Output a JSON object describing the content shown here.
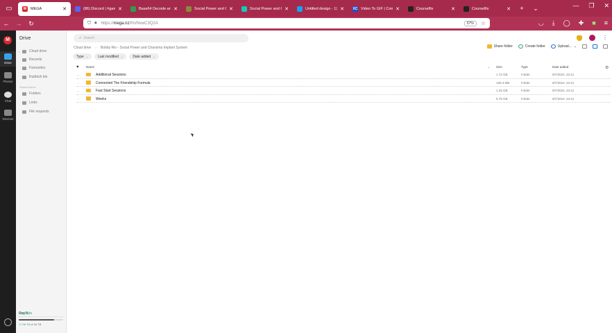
{
  "browser": {
    "tabs": [
      {
        "title": "MEGA",
        "color": "#d9272e",
        "icon": "mega-logo-icon",
        "active": true,
        "fav": "M"
      },
      {
        "title": "(86) Discord | #gam",
        "color": "#5865f2",
        "icon": "discord-icon",
        "active": false,
        "fav": ""
      },
      {
        "title": "Base64 Decode and E",
        "color": "#2e9e4a",
        "icon": "base64-icon",
        "active": false,
        "fav": ""
      },
      {
        "title": "Social Power and Cha",
        "color": "#8a8a3a",
        "icon": "page-icon",
        "active": false,
        "fav": ""
      },
      {
        "title": "Social Power and Cha",
        "color": "#16c7b8",
        "icon": "canva-icon",
        "active": false,
        "fav": ""
      },
      {
        "title": "Untitled design - 120",
        "color": "#1aa1f0",
        "icon": "canva-icon",
        "active": false,
        "fav": ""
      },
      {
        "title": "Video To GIF | Conver",
        "color": "#1f4fd1",
        "icon": "xc-icon",
        "active": false,
        "fav": "XC"
      },
      {
        "title": "Courseflix",
        "color": "#222222",
        "icon": "courseflix-icon",
        "active": false,
        "fav": ""
      },
      {
        "title": "Courseflix",
        "color": "#222222",
        "icon": "courseflix-icon",
        "active": false,
        "fav": ""
      }
    ],
    "url_host": "mega.nz",
    "url_prefix": "https://",
    "url_path": "/fm/NxwC3Q2A",
    "zoom": "67%"
  },
  "rail": {
    "items": [
      {
        "label": "Drive",
        "active": true
      },
      {
        "label": "Photos",
        "active": false
      },
      {
        "label": "Chat",
        "active": false
      },
      {
        "label": "Devices",
        "active": false
      }
    ]
  },
  "sidebar": {
    "title": "Drive",
    "items": [
      {
        "label": "Cloud drive",
        "icon": "cloud-icon"
      },
      {
        "label": "Recents",
        "icon": "clock-icon"
      },
      {
        "label": "Favourites",
        "icon": "heart-icon"
      },
      {
        "label": "Rubbish bin",
        "icon": "trash-icon"
      }
    ],
    "section": "Shared items",
    "shared": [
      {
        "label": "Folders",
        "icon": "shared-folder-icon"
      },
      {
        "label": "Links",
        "icon": "link-icon"
      },
      {
        "label": "File requests",
        "icon": "file-request-icon"
      }
    ],
    "storage": {
      "plan": "Pro III",
      "upgrade": "Upgrade",
      "used": "17.98 TB",
      "of": "of 16 TB",
      "fraction": 0.8
    }
  },
  "main": {
    "search_placeholder": "Search",
    "breadcrumb": [
      "Cloud drive",
      "Bobby Rio - Social Power and Charisma Implant System"
    ],
    "actions": {
      "share": "Share folder",
      "create": "Create folder",
      "upload": "Upload..."
    },
    "filters": [
      "Type",
      "Last modified",
      "Date added"
    ],
    "columns": {
      "name": "Name",
      "size": "Size",
      "type": "Type",
      "date": "Date added"
    },
    "rows": [
      {
        "name": "Additional Sessions",
        "size": "1.72 GB",
        "type": "Folder",
        "date": "9/7/2024, 23:41"
      },
      {
        "name": "Connected The Friendship Formula",
        "size": "169.3 MB",
        "type": "Folder",
        "date": "9/7/2024, 23:41"
      },
      {
        "name": "Fast Start Sessions",
        "size": "1.25 GB",
        "type": "Folder",
        "date": "9/7/2024, 23:41"
      },
      {
        "name": "Weeks",
        "size": "5.79 GB",
        "type": "Folder",
        "date": "9/7/2024, 23:41"
      }
    ]
  }
}
